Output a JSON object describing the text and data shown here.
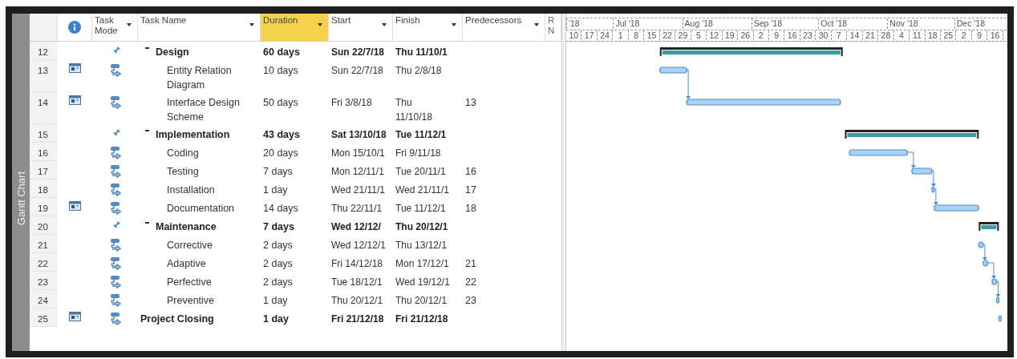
{
  "view_bar": {
    "label": "Gantt Chart"
  },
  "columns": [
    {
      "kind": "info",
      "selected": false
    },
    {
      "kind": "text",
      "label": "Task Mode",
      "selected": false
    },
    {
      "kind": "text",
      "label": "Task Name",
      "selected": false
    },
    {
      "kind": "text",
      "label": "Duration",
      "selected": true
    },
    {
      "kind": "text",
      "label": "Start",
      "selected": false
    },
    {
      "kind": "text",
      "label": "Finish",
      "selected": false
    },
    {
      "kind": "text",
      "label": "Predecessors",
      "selected": false
    },
    {
      "kind": "cut",
      "lines": [
        "R",
        "N"
      ],
      "selected": false
    }
  ],
  "tasks": [
    {
      "id": "12",
      "note": false,
      "kind": "manual",
      "name": "Design",
      "expanded": true,
      "duration": "60 days",
      "start": "Sun 22/7/18",
      "finish": "Thu 11/10/1",
      "linked": false,
      "children": [
        {
          "id": "13",
          "note": true,
          "kind": "auto",
          "name": "Entity Relation Diagram",
          "duration": "10 days",
          "start": "Sun 22/7/18",
          "finish": "Thu 2/8/18",
          "linked": false
        },
        {
          "id": "14",
          "note": true,
          "kind": "auto",
          "name": "Interface Design Scheme",
          "duration": "50 days",
          "start": "Fri 3/8/18",
          "finish": "Thu\n11/10/18",
          "predecessors": "13",
          "linked": true
        }
      ]
    },
    {
      "id": "15",
      "note": false,
      "kind": "manual",
      "name": "Implementation",
      "expanded": true,
      "duration": "43 days",
      "start": "Sat 13/10/18",
      "finish": "Tue 11/12/1",
      "linked": false,
      "children": [
        {
          "id": "16",
          "note": false,
          "kind": "auto",
          "name": "Coding",
          "duration": "20 days",
          "start": "Mon 15/10/1",
          "finish": "Fri 9/11/18",
          "linked": false
        },
        {
          "id": "17",
          "note": false,
          "kind": "auto",
          "name": "Testing",
          "duration": "7 days",
          "start": "Mon 12/11/1",
          "finish": "Tue 20/11/1",
          "predecessors": "16",
          "linked": true
        },
        {
          "id": "18",
          "note": false,
          "kind": "auto",
          "name": "Installation",
          "duration": "1 day",
          "start": "Wed 21/11/1",
          "finish": "Wed 21/11/1",
          "predecessors": "17",
          "linked": true
        },
        {
          "id": "19",
          "note": true,
          "kind": "auto",
          "name": "Documentation",
          "duration": "14 days",
          "start": "Thu 22/11/1",
          "finish": "Tue 11/12/1",
          "predecessors": "18",
          "linked": true
        }
      ]
    },
    {
      "id": "20",
      "note": false,
      "kind": "manual",
      "name": "Maintenance",
      "expanded": true,
      "duration": "7 days",
      "start": "Wed 12/12/",
      "finish": "Thu 20/12/1",
      "linked": false,
      "children": [
        {
          "id": "21",
          "note": false,
          "kind": "auto",
          "name": "Corrective",
          "duration": "2 days",
          "start": "Wed 12/12/1",
          "finish": "Thu 13/12/1",
          "linked": false
        },
        {
          "id": "22",
          "note": false,
          "kind": "auto",
          "name": "Adaptive",
          "duration": "2 days",
          "start": "Fri 14/12/18",
          "finish": "Mon 17/12/1",
          "predecessors": "21",
          "linked": true
        },
        {
          "id": "23",
          "note": false,
          "kind": "auto",
          "name": "Perfective",
          "duration": "2 days",
          "start": "Tue 18/12/1",
          "finish": "Wed 19/12/1",
          "predecessors": "22",
          "linked": true
        },
        {
          "id": "24",
          "note": false,
          "kind": "auto",
          "name": "Preventive",
          "duration": "1 day",
          "start": "Thu 20/12/1",
          "finish": "Thu 20/12/1",
          "predecessors": "23",
          "linked": true
        }
      ]
    },
    {
      "id": "25",
      "note": true,
      "kind": "auto",
      "name": "Project Closing",
      "duration": "1 day",
      "start": "Fri 21/12/18",
      "finish": "Fri 21/12/18",
      "linked": false
    }
  ],
  "timescale": {
    "months": [
      "'18",
      "Jul '18",
      "Aug '18",
      "Sep '18",
      "Oct '18",
      "Nov '18",
      "Dec '18"
    ],
    "weeks": [
      "10",
      "17",
      "24",
      "1",
      "8",
      "15",
      "22",
      "29",
      "5",
      "12",
      "19",
      "26",
      "2",
      "9",
      "16",
      "23",
      "30",
      "7",
      "14",
      "21",
      "28",
      "4",
      "11",
      "18",
      "25",
      "2",
      "9",
      "16"
    ]
  }
}
